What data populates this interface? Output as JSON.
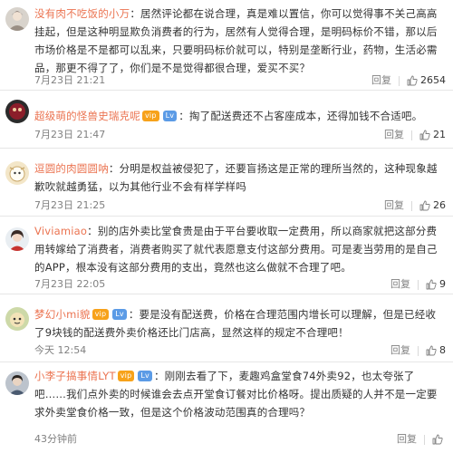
{
  "colors": {
    "username": "#eb7350",
    "meta": "#808080",
    "divider": "#e6e6e6"
  },
  "comments": [
    {
      "user": "没有肉不吃饭的小万",
      "text": "：居然评论都在说合理，真是难以置信，你可以觉得事不关己高高挂起，但是这种明显欺负消费者的行为，居然有人觉得合理，是明码标价不错，那以后市场价格是不是都可以乱来，只要明码标价就可以，特别是垄断行业，药物，生活必需品，那更不得了了，你们是不是觉得都很合理，爱买不买？",
      "time": "7月23日 21:21",
      "reply": "回复",
      "likes": "2654"
    },
    {
      "user": "超级萌的怪兽史瑞克呢",
      "badges": [
        "vip",
        "Lv"
      ],
      "text": "：掏了配送费还不占客座成本，还得加钱不合适吧。",
      "time": "7月23日 21:47",
      "reply": "回复",
      "likes": "21"
    },
    {
      "user": "逗圆的肉圆圆呐",
      "text": "：分明是权益被侵犯了，还要盲扬这是正常的理所当然的，这种现象越歉吹就越勇猛，以为其他行业不会有样学样吗",
      "time": "7月23日 21:25",
      "reply": "回复",
      "likes": "26"
    },
    {
      "user": "Viviamiao",
      "text": "：别的店外卖比堂食贵是由于平台要收取一定费用，所以商家就把这部分费用转嫁给了消费者，消费者购买了就代表愿意支付这部分费用。可是麦当劳用的是自己的APP，根本没有这部分费用的支出，竟然也这么做就不合理了吧。",
      "time": "7月23日 22:05",
      "reply": "回复",
      "likes": "9"
    },
    {
      "user": "梦幻小mi貌",
      "badges": [
        "vip",
        "Lv"
      ],
      "text": "：要是没有配送费，价格在合理范围内增长可以理解，但是已经收了9块钱的配送费外卖价格还比门店高，显然这样的规定不合理吧！",
      "time": "今天 12:54",
      "reply": "回复",
      "likes": "8"
    },
    {
      "user": "小李子搞事情LYT",
      "badges": [
        "vip",
        "Lv"
      ],
      "text": "：刚刚去看了下，麦趣鸡盒堂食74外卖92，也太夸张了吧……我们点外卖的时候谁会去点开堂食订餐对比价格呀。提出质疑的人并不是一定要求外卖堂食价格一致，但是这个价格波动范围真的合理吗？",
      "time": "43分钟前",
      "reply": "回复",
      "likes": ""
    }
  ]
}
